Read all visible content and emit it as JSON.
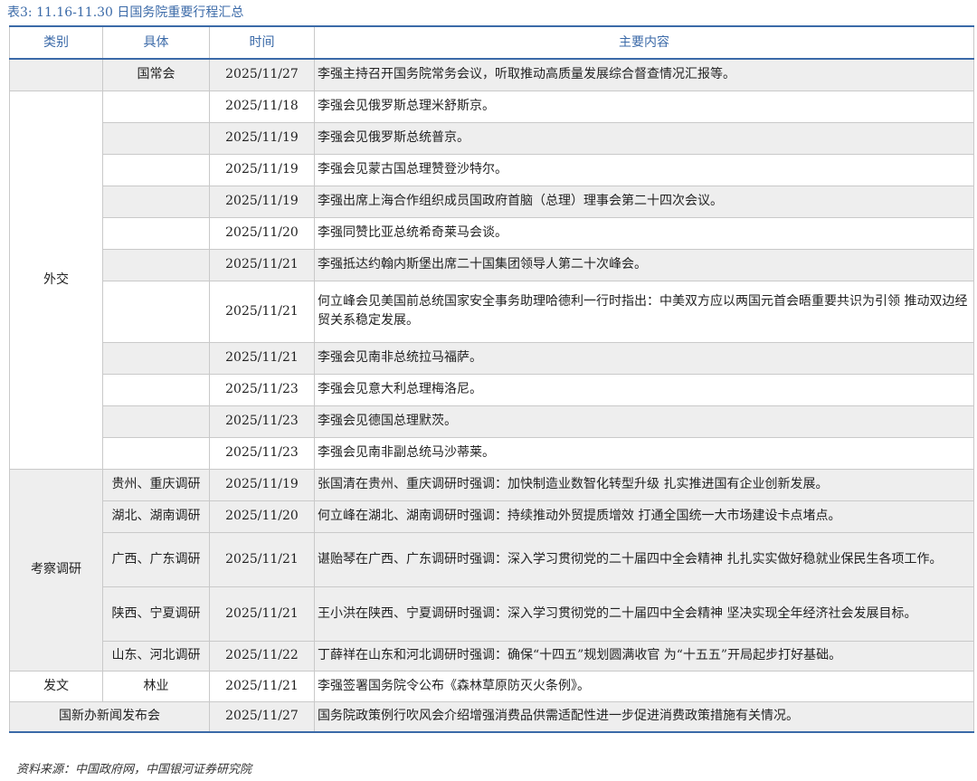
{
  "caption": "表3: 11.16-11.30 日国务院重要行程汇总",
  "headers": [
    "类别",
    "具体",
    "时间",
    "主要内容"
  ],
  "rows": [
    {
      "cat": "",
      "sub": "国常会",
      "date": "2025/11/27",
      "content": "李强主持召开国务院常务会议，听取推动高质量发展综合督查情况汇报等。"
    },
    {
      "cat": "外交",
      "sub": "",
      "date": "2025/11/18",
      "content": "李强会见俄罗斯总理米舒斯京。"
    },
    {
      "cat": "",
      "sub": "",
      "date": "2025/11/19",
      "content": "李强会见俄罗斯总统普京。"
    },
    {
      "cat": "",
      "sub": "",
      "date": "2025/11/19",
      "content": "李强会见蒙古国总理赞登沙特尔。"
    },
    {
      "cat": "",
      "sub": "",
      "date": "2025/11/19",
      "content": "李强出席上海合作组织成员国政府首脑（总理）理事会第二十四次会议。"
    },
    {
      "cat": "",
      "sub": "",
      "date": "2025/11/20",
      "content": "李强同赞比亚总统希奇莱马会谈。"
    },
    {
      "cat": "",
      "sub": "",
      "date": "2025/11/21",
      "content": "李强抵达约翰内斯堡出席二十国集团领导人第二十次峰会。"
    },
    {
      "cat": "",
      "sub": "",
      "date": "2025/11/21",
      "content": "何立峰会见美国前总统国家安全事务助理哈德利一行时指出：中美双方应以两国元首会晤重要共识为引领 推动双边经贸关系稳定发展。"
    },
    {
      "cat": "",
      "sub": "",
      "date": "2025/11/21",
      "content": "李强会见南非总统拉马福萨。"
    },
    {
      "cat": "",
      "sub": "",
      "date": "2025/11/23",
      "content": "李强会见意大利总理梅洛尼。"
    },
    {
      "cat": "",
      "sub": "",
      "date": "2025/11/23",
      "content": "李强会见德国总理默茨。"
    },
    {
      "cat": "",
      "sub": "",
      "date": "2025/11/23",
      "content": "李强会见南非副总统马沙蒂莱。"
    },
    {
      "cat": "考察调研",
      "sub": "贵州、重庆调研",
      "date": "2025/11/19",
      "content": "张国清在贵州、重庆调研时强调：加快制造业数智化转型升级 扎实推进国有企业创新发展。"
    },
    {
      "cat": "",
      "sub": "湖北、湖南调研",
      "date": "2025/11/20",
      "content": "何立峰在湖北、湖南调研时强调：持续推动外贸提质增效 打通全国统一大市场建设卡点堵点。"
    },
    {
      "cat": "",
      "sub": "广西、广东调研",
      "date": "2025/11/21",
      "content": "谌贻琴在广西、广东调研时强调：深入学习贯彻党的二十届四中全会精神 扎扎实实做好稳就业保民生各项工作。"
    },
    {
      "cat": "",
      "sub": "陕西、宁夏调研",
      "date": "2025/11/21",
      "content": "王小洪在陕西、宁夏调研时强调：深入学习贯彻党的二十届四中全会精神 坚决实现全年经济社会发展目标。"
    },
    {
      "cat": "",
      "sub": "山东、河北调研",
      "date": "2025/11/22",
      "content": "丁薛祥在山东和河北调研时强调：确保“十四五”规划圆满收官 为“十五五”开局起步打好基础。"
    },
    {
      "cat": "发文",
      "sub": "林业",
      "date": "2025/11/21",
      "content": "李强签署国务院令公布《森林草原防灭火条例》。"
    },
    {
      "cat": "国新办新闻发布会",
      "sub": "",
      "date": "2025/11/27",
      "content": "国务院政策例行吹风会介绍增强消费品供需适配性进一步促进消费政策措施有关情况。"
    }
  ],
  "source": "资料来源：中国政府网，中国银河证券研究院"
}
